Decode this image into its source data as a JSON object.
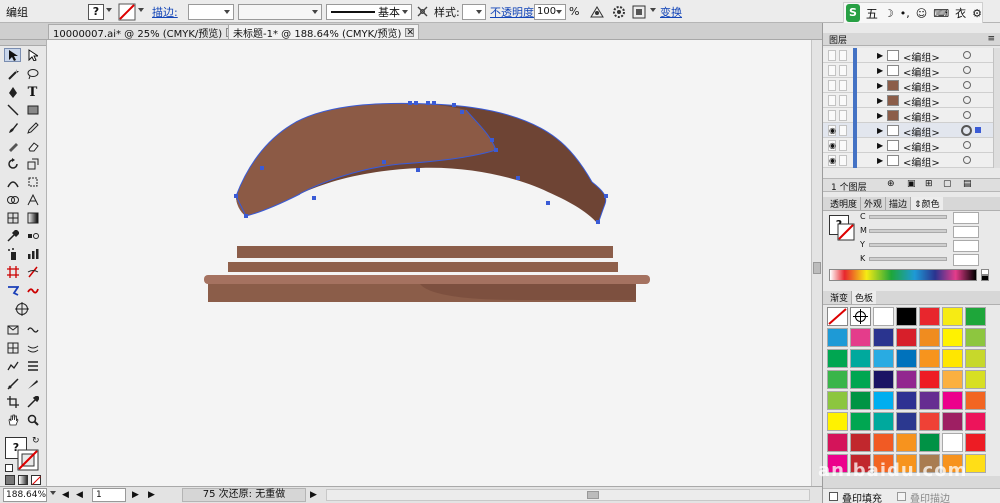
{
  "control_bar": {
    "selection_label": "编组",
    "stroke_label": "描边:",
    "stroke_profile": "基本",
    "style_label": "样式:",
    "opacity_label": "不透明度:",
    "opacity_value": "100",
    "percent": "%",
    "transform_label": "变换",
    "fill_symbol": "?"
  },
  "ime_toolbar": {
    "logo": "S",
    "mode": "五",
    "moon": "☽",
    "punct": "•,",
    "face": "☺",
    "keyboard": "⌨",
    "shirt": "衣",
    "wrench": "⚙"
  },
  "tabs": [
    {
      "label": "10000007.ai* @ 25% (CMYK/预览)",
      "close": "✕"
    },
    {
      "label": "未标题-1* @ 188.64% (CMYK/预览)",
      "close": "✕"
    }
  ],
  "status_bar": {
    "zoom": "188.64%",
    "artboard": "1",
    "undo_text": "75 次还原: 无重做",
    "nav_first": "◀",
    "nav_prev": "◀",
    "nav_next": "▶",
    "nav_last": "▶"
  },
  "layers_panel": {
    "title": "图层",
    "rows": [
      {
        "name": "<编组>",
        "visible": false
      },
      {
        "name": "<编组>",
        "visible": false
      },
      {
        "name": "<编组>",
        "visible": false
      },
      {
        "name": "<编组>",
        "visible": false
      },
      {
        "name": "<编组>",
        "visible": false
      },
      {
        "name": "<编组>",
        "visible": true,
        "selected": true
      },
      {
        "name": "<编组>",
        "visible": true
      },
      {
        "name": "<编组>",
        "visible": true
      }
    ],
    "layer_count": "1 个图层"
  },
  "color_panel": {
    "tabs": [
      "透明度",
      "外观",
      "描边",
      "颜色"
    ],
    "active_tab": "颜色",
    "channels": [
      "C",
      "M",
      "Y",
      "K"
    ],
    "fill_symbol": "?"
  },
  "swatches_panel": {
    "tabs": [
      "渐变",
      "色板"
    ],
    "active_tab": "色板",
    "colors": [
      "#ffffff",
      "#000000",
      "#e8262d",
      "#f6eb14",
      "#1ea63a",
      "#1e9ad6",
      "#e43c8b",
      "#2a348f",
      "#d71f2a",
      "#f08c1f",
      "#fff200",
      "#8dc63f",
      "#00a651",
      "#00a99d",
      "#29abe2",
      "#0072bc",
      "#f7941d",
      "#ffe600",
      "#c7d82b",
      "#39b54a",
      "#00a651",
      "#1b1464",
      "#92278f",
      "#ed1c24",
      "#fbb040",
      "#d7df23",
      "#8cc63f",
      "#009444",
      "#00aeef",
      "#2e3192",
      "#662d91",
      "#ec008c",
      "#f26522",
      "#fff200",
      "#00a651",
      "#00a99d",
      "#2b388f",
      "#ef4136",
      "#9e1f63",
      "#ed145b",
      "#d4145a",
      "#c1272d",
      "#f15a24",
      "#f7931e",
      "#009245",
      "#ffffff",
      "#ed1c24",
      "#ec008c",
      "#c1272d",
      "#f26522",
      "#f7941d",
      "#a97c50",
      "#f7931e",
      "#ffde17",
      "#8dc63f",
      "#ed1c24",
      "#f26522",
      "#f7941d",
      "#fff200",
      "#22b573",
      "#0071bc",
      "#2e3192",
      "#662d91"
    ],
    "overprint_fill": "叠印填充",
    "overprint_stroke": "叠印描边"
  },
  "colors": {
    "wood_light": "#8c5a45",
    "wood_dark": "#6e4434",
    "shelf_top": "#8b5d49",
    "shelf_light": "#a57260",
    "selection": "#3a5bd6"
  },
  "watermark": "an.baidu.com"
}
